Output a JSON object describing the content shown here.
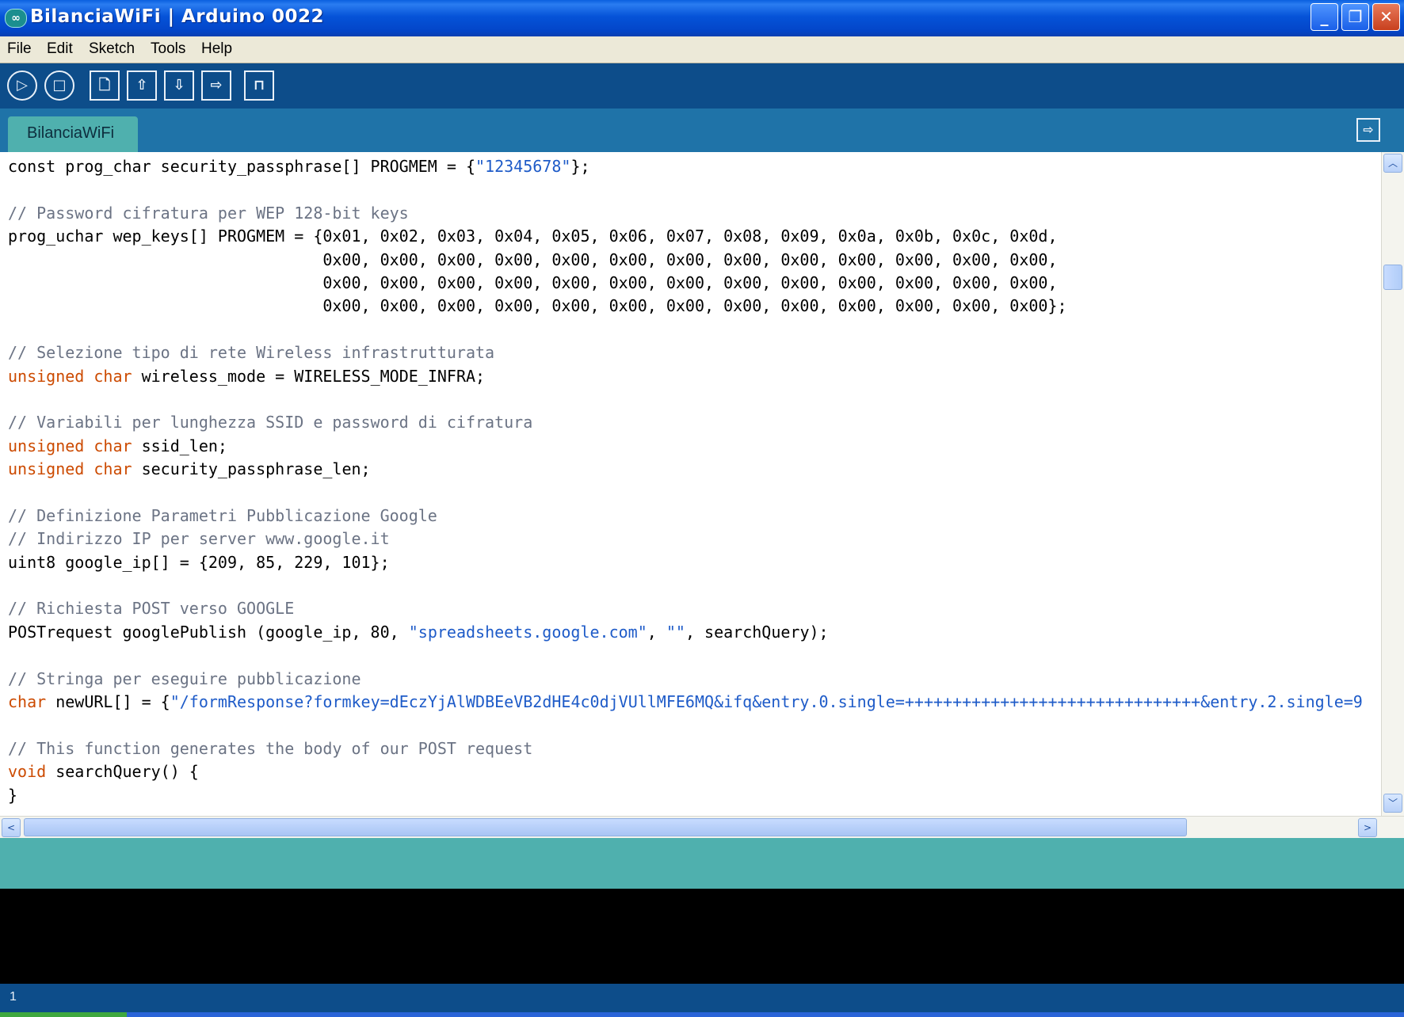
{
  "window": {
    "title": "BilanciaWiFi | Arduino 0022",
    "logo": "∞",
    "minimize_glyph": "_",
    "maximize_glyph": "❐",
    "close_glyph": "✕"
  },
  "menu": [
    "File",
    "Edit",
    "Sketch",
    "Tools",
    "Help"
  ],
  "toolbar": {
    "icons": [
      "verify-icon",
      "stop-icon",
      "new-icon",
      "open-icon",
      "save-icon",
      "upload-icon",
      "serial-monitor-icon"
    ],
    "glyphs": [
      "▷",
      "□",
      "🗋",
      "⇧",
      "⇩",
      "⇨",
      "⊓"
    ]
  },
  "tab": {
    "label": "BilanciaWiFi",
    "serial_monitor_glyph": "⇨"
  },
  "code_lines": [
    [
      [
        "",
        "const prog_char security_passphrase[] PROGMEM = {"
      ],
      [
        "str",
        "\"12345678\""
      ],
      [
        "",
        "};"
      ]
    ],
    [],
    [
      [
        "cmt",
        "// Password cifratura per WEP 128-bit keys"
      ]
    ],
    [
      [
        "",
        "prog_uchar wep_keys[] PROGMEM = {0x01, 0x02, 0x03, 0x04, 0x05, 0x06, 0x07, 0x08, 0x09, 0x0a, 0x0b, 0x0c, 0x0d,"
      ]
    ],
    [
      [
        "",
        "                                 0x00, 0x00, 0x00, 0x00, 0x00, 0x00, 0x00, 0x00, 0x00, 0x00, 0x00, 0x00, 0x00,"
      ]
    ],
    [
      [
        "",
        "                                 0x00, 0x00, 0x00, 0x00, 0x00, 0x00, 0x00, 0x00, 0x00, 0x00, 0x00, 0x00, 0x00,"
      ]
    ],
    [
      [
        "",
        "                                 0x00, 0x00, 0x00, 0x00, 0x00, 0x00, 0x00, 0x00, 0x00, 0x00, 0x00, 0x00, 0x00};"
      ]
    ],
    [],
    [
      [
        "cmt",
        "// Selezione tipo di rete Wireless infrastrutturata"
      ]
    ],
    [
      [
        "kw",
        "unsigned"
      ],
      [
        "",
        " "
      ],
      [
        "kw",
        "char"
      ],
      [
        "",
        " wireless_mode = WIRELESS_MODE_INFRA;"
      ]
    ],
    [],
    [
      [
        "cmt",
        "// Variabili per lunghezza SSID e password di cifratura"
      ]
    ],
    [
      [
        "kw",
        "unsigned"
      ],
      [
        "",
        " "
      ],
      [
        "kw",
        "char"
      ],
      [
        "",
        " ssid_len;"
      ]
    ],
    [
      [
        "kw",
        "unsigned"
      ],
      [
        "",
        " "
      ],
      [
        "kw",
        "char"
      ],
      [
        "",
        " security_passphrase_len;"
      ]
    ],
    [],
    [
      [
        "cmt",
        "// Definizione Parametri Pubblicazione Google"
      ]
    ],
    [
      [
        "cmt",
        "// Indirizzo IP per server www.google.it"
      ]
    ],
    [
      [
        "",
        "uint8 google_ip[] = {209, 85, 229, 101};"
      ]
    ],
    [],
    [
      [
        "cmt",
        "// Richiesta POST verso GOOGLE"
      ]
    ],
    [
      [
        "",
        "POSTrequest googlePublish (google_ip, 80, "
      ],
      [
        "str",
        "\"spreadsheets.google.com\""
      ],
      [
        "",
        ", "
      ],
      [
        "str",
        "\"\""
      ],
      [
        "",
        ", searchQuery);"
      ]
    ],
    [],
    [
      [
        "cmt",
        "// Stringa per eseguire pubblicazione"
      ]
    ],
    [
      [
        "kw",
        "char"
      ],
      [
        "",
        " newURL[] = {"
      ],
      [
        "str",
        "\"/formResponse?formkey=dEczYjAlWDBEeVB2dHE4c0djVUllMFE6MQ&ifq&entry.0.single=+++++++++++++++++++++++++++++++&entry.2.single=9"
      ]
    ],
    [],
    [
      [
        "cmt",
        "// This function generates the body of our POST request"
      ]
    ],
    [
      [
        "kw",
        "void"
      ],
      [
        "",
        " searchQuery() {"
      ]
    ],
    [
      [
        "",
        "}"
      ]
    ]
  ],
  "scrollbars": {
    "up_glyph": "︿",
    "down_glyph": "﹀",
    "left_glyph": "<",
    "right_glyph": ">",
    "grip_glyph": "≡",
    "hgrip_glyph": "|||"
  },
  "status": {
    "line_number": "1"
  },
  "colors": {
    "keyword": "#cc4a00",
    "string": "#1e5bc8",
    "comment": "#6b7384",
    "toolbar_bg": "#0d4d8a",
    "tab_bg": "#4fb0ae"
  }
}
